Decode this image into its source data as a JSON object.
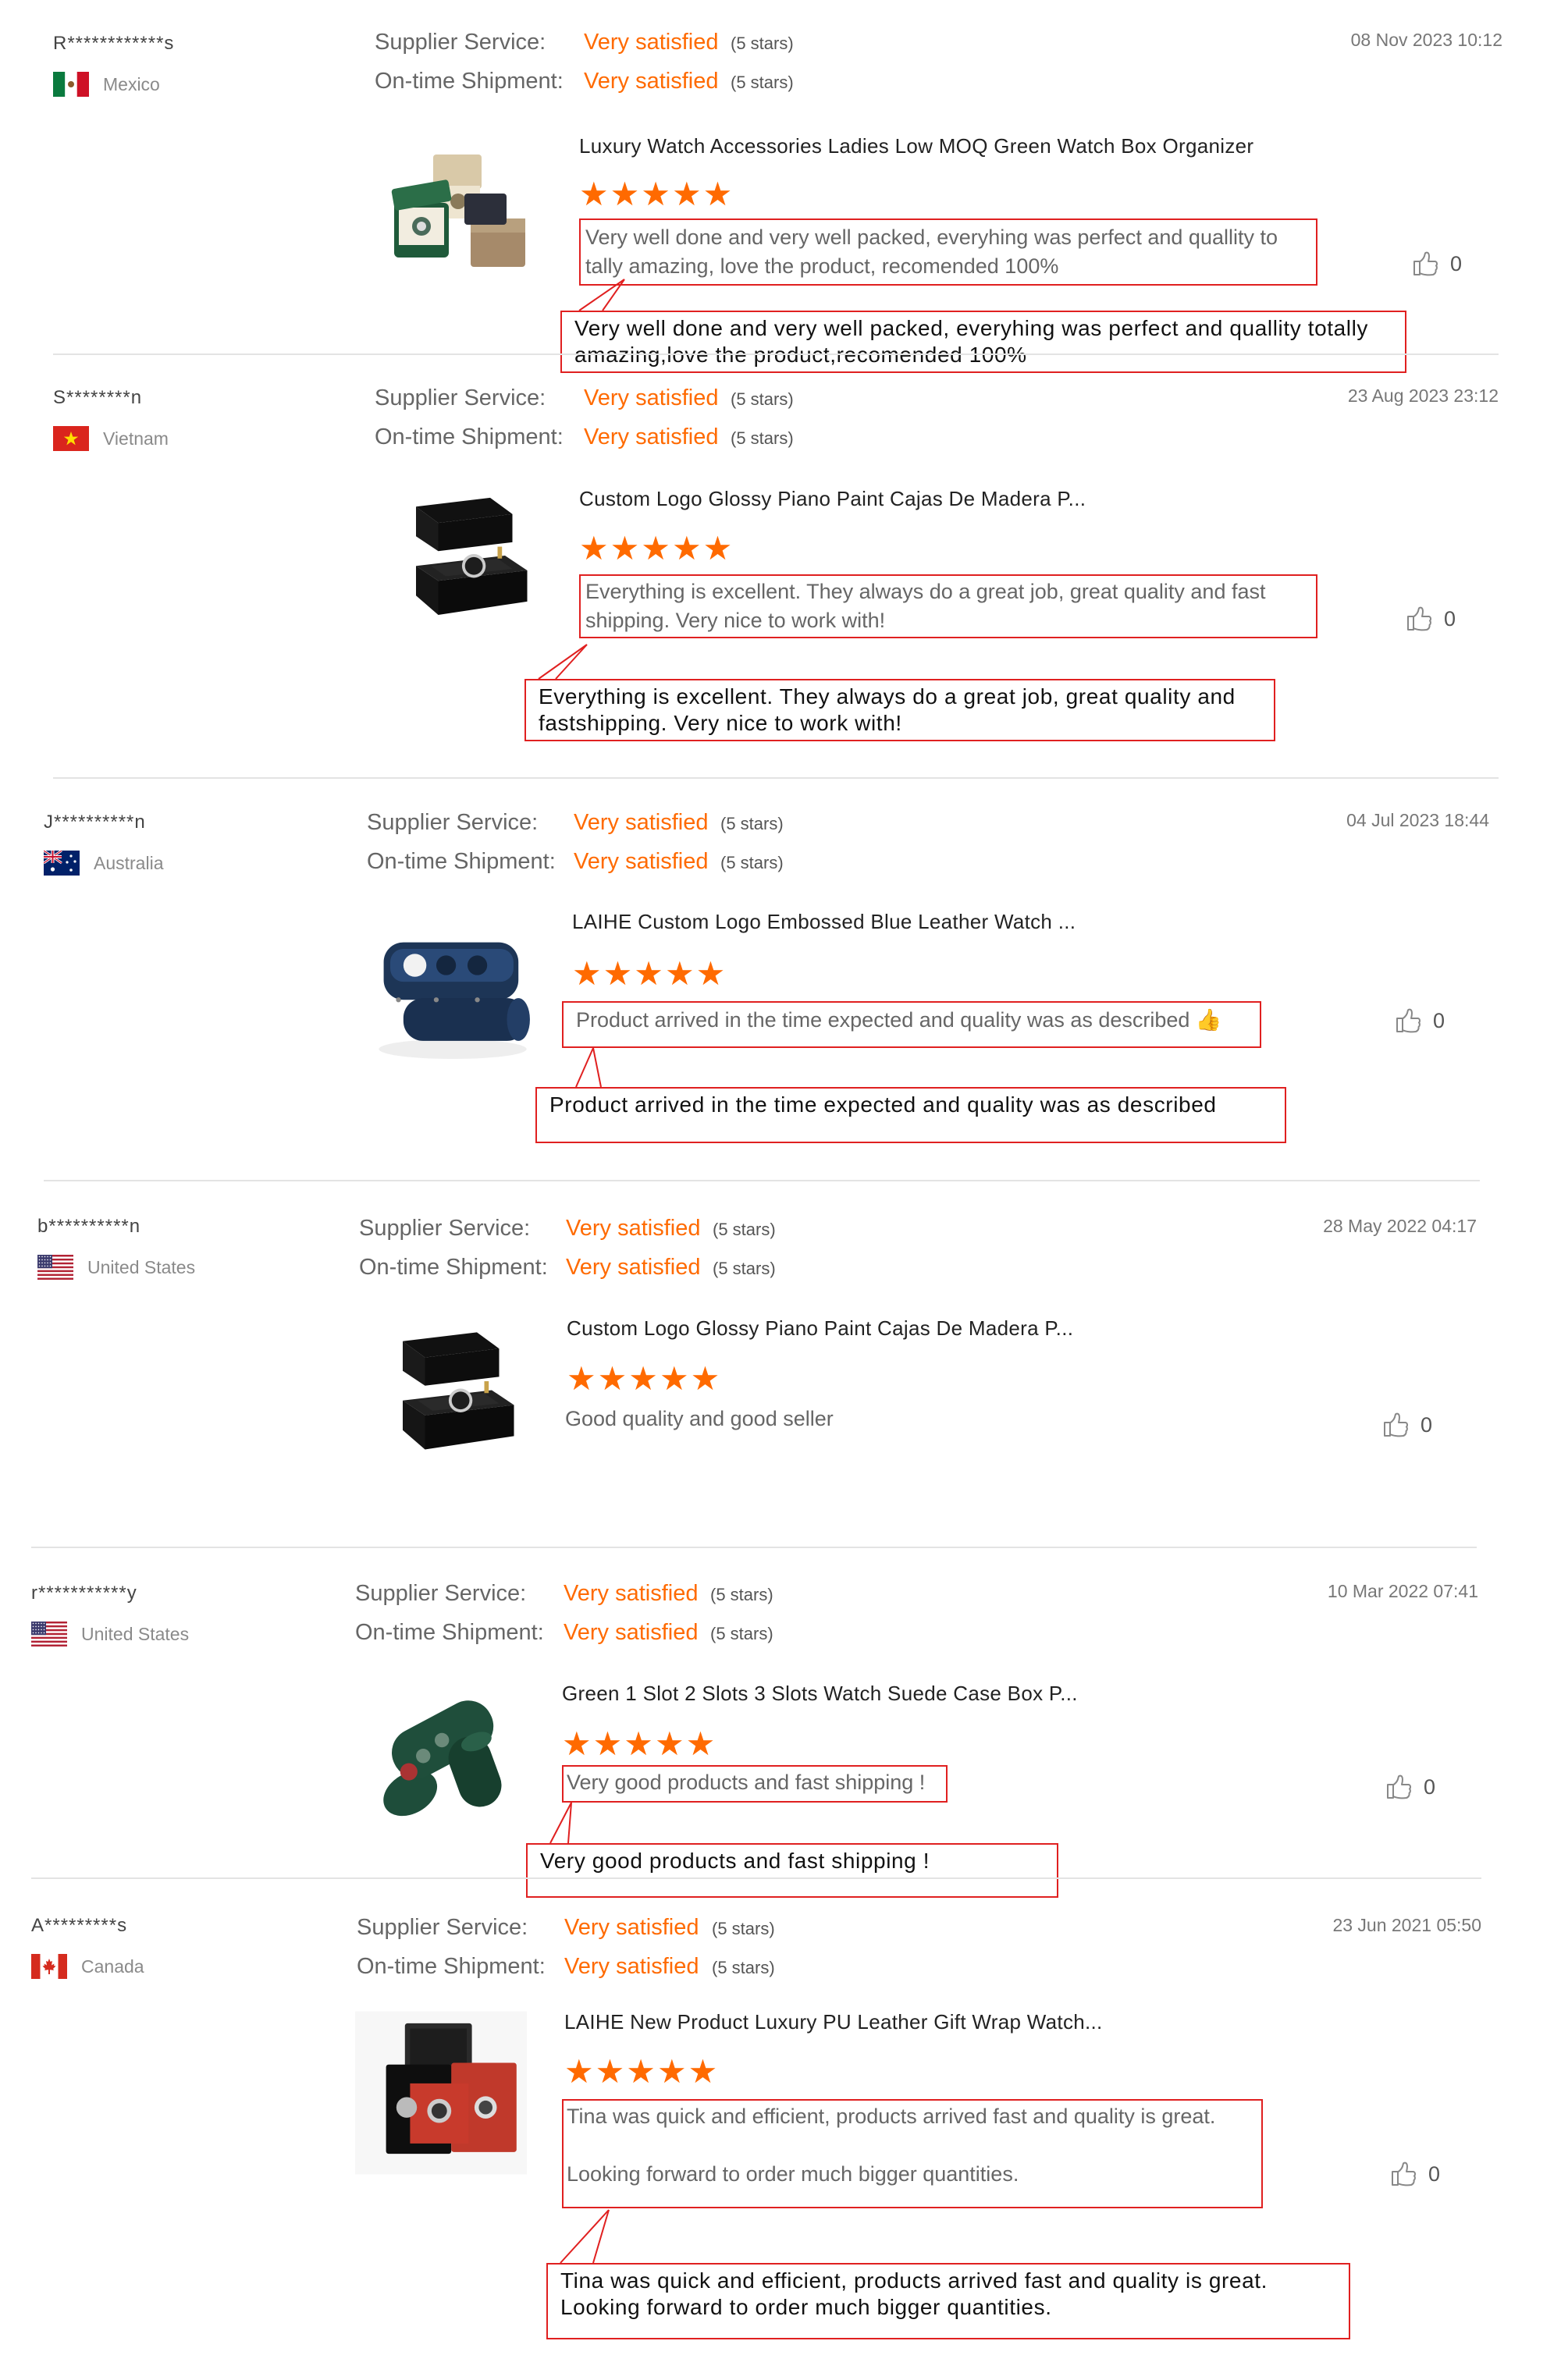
{
  "labels": {
    "supplier_service": "Supplier Service:",
    "ontime_shipment": "On-time Shipment:",
    "satisfied": "Very satisfied",
    "stars_count": "(5 stars)",
    "stars_glyphs": "★★★★★"
  },
  "colors": {
    "accent": "#ff6a00",
    "highlight_border": "#e02020"
  },
  "reviews": [
    {
      "user": "R************s",
      "country": "Mexico",
      "flag": "mexico-flag",
      "date": "08 Nov 2023 10:12",
      "product": "Luxury Watch Accessories Ladies Low MOQ Green Watch Box Organizer",
      "image": "green-watch-box-organizer",
      "rating": 5,
      "comment": "Very well done and very well packed, everyhing was perfect and quallity to tally amazing, love the product, recomended 100%",
      "callout": "Very well done and very well packed, everyhing was perfect and quallity totally amazing,love the product,recomended 100%",
      "likes": "0"
    },
    {
      "user": "S********n",
      "country": "Vietnam",
      "flag": "vietnam-flag",
      "date": "23 Aug 2023 23:12",
      "product": "Custom Logo Glossy Piano Paint Cajas De Madera P...",
      "image": "black-piano-watch-box",
      "rating": 5,
      "comment": "Everything is excellent.  They always do a great job, great quality and fast shipping.  Very nice to work with!",
      "callout": "Everything is excellent. They always do a great job, great quality and fastshipping. Very nice to work with!",
      "likes": "0"
    },
    {
      "user": "J**********n",
      "country": "Australia",
      "flag": "australia-flag",
      "date": "04 Jul 2023 18:44",
      "product": "LAIHE Custom Logo Embossed Blue Leather Watch ...",
      "image": "blue-leather-watch-roll",
      "rating": 5,
      "comment": "Product arrived in the time expected and quality was as described 👍",
      "callout": "Product arrived in the time expected and quality was as described",
      "likes": "0"
    },
    {
      "user": "b**********n",
      "country": "United States",
      "flag": "us-flag",
      "date": "28 May 2022 04:17",
      "product": "Custom Logo Glossy Piano Paint Cajas De Madera P...",
      "image": "black-piano-watch-box",
      "rating": 5,
      "comment": "Good quality and good seller",
      "callout": "",
      "likes": "0"
    },
    {
      "user": "r***********y",
      "country": "United States",
      "flag": "us-flag",
      "date": "10 Mar 2022 07:41",
      "product": "Green 1 Slot 2 Slots 3 Slots Watch Suede Case Box P...",
      "image": "green-suede-watch-roll",
      "rating": 5,
      "comment": "Very good products and fast shipping !",
      "callout": "Very good products and fast shipping !",
      "likes": "0"
    },
    {
      "user": "A*********s",
      "country": "Canada",
      "flag": "canada-flag",
      "date": "23 Jun 2021 05:50",
      "product": "LAIHE New Product Luxury PU Leather Gift Wrap Watch...",
      "image": "red-black-gift-watch-boxes",
      "rating": 5,
      "comment": "Tina was quick and efficient, products arrived fast and quality is great.\n\nLooking forward to order much bigger quantities.",
      "callout": "Tina was quick and efficient, products arrived fast and quality is great.\nLooking forward to order much bigger quantities.",
      "likes": "0"
    }
  ]
}
